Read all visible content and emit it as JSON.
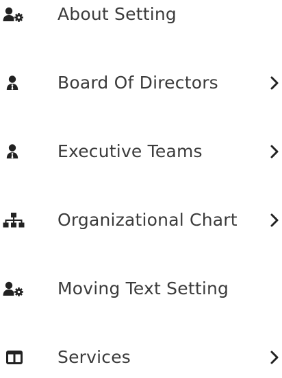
{
  "menu": {
    "items": [
      {
        "label": "About Setting",
        "icon": "user-gear-icon",
        "has_submenu": false
      },
      {
        "label": "Board Of Directors",
        "icon": "user-tie-icon",
        "has_submenu": true
      },
      {
        "label": "Executive Teams",
        "icon": "user-tie-icon",
        "has_submenu": true
      },
      {
        "label": "Organizational Chart",
        "icon": "sitemap-icon",
        "has_submenu": true
      },
      {
        "label": "Moving Text Setting",
        "icon": "user-gear-icon",
        "has_submenu": false
      },
      {
        "label": "Services",
        "icon": "columns-icon",
        "has_submenu": true
      }
    ]
  },
  "colors": {
    "text": "#3b3b3b",
    "icon": "#222222",
    "background": "#ffffff"
  }
}
